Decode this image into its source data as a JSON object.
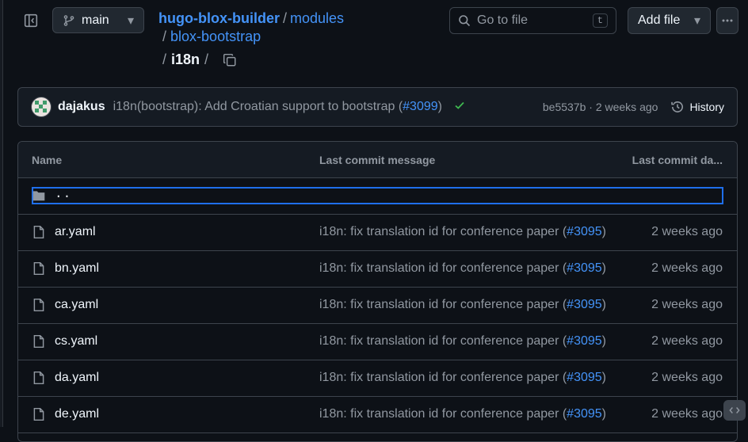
{
  "header": {
    "branch": "main",
    "repo": "hugo-blox-builder",
    "path1": "modules",
    "path2": "blox-bootstrap",
    "current": "i18n",
    "sep": "/",
    "goto_placeholder": "Go to file",
    "goto_shortcut": "t",
    "add_file": "Add file"
  },
  "commit": {
    "author": "dajakus",
    "message_prefix": "i18n(bootstrap): Add Croatian support to bootstrap (",
    "pr": "#3099",
    "message_suffix": ")",
    "sha_time": "be5537b · 2 weeks ago",
    "history": "History"
  },
  "table": {
    "col_name": "Name",
    "col_msg": "Last commit message",
    "col_date": "Last commit da...",
    "parent": "..",
    "rows": [
      {
        "name": "ar.yaml",
        "msg": "i18n: fix translation id for conference paper (",
        "pr": "#3095",
        "end": ")",
        "date": "2 weeks ago"
      },
      {
        "name": "bn.yaml",
        "msg": "i18n: fix translation id for conference paper (",
        "pr": "#3095",
        "end": ")",
        "date": "2 weeks ago"
      },
      {
        "name": "ca.yaml",
        "msg": "i18n: fix translation id for conference paper (",
        "pr": "#3095",
        "end": ")",
        "date": "2 weeks ago"
      },
      {
        "name": "cs.yaml",
        "msg": "i18n: fix translation id for conference paper (",
        "pr": "#3095",
        "end": ")",
        "date": "2 weeks ago"
      },
      {
        "name": "da.yaml",
        "msg": "i18n: fix translation id for conference paper (",
        "pr": "#3095",
        "end": ")",
        "date": "2 weeks ago"
      },
      {
        "name": "de.yaml",
        "msg": "i18n: fix translation id for conference paper (",
        "pr": "#3095",
        "end": ")",
        "date": "2 weeks ago"
      }
    ]
  }
}
